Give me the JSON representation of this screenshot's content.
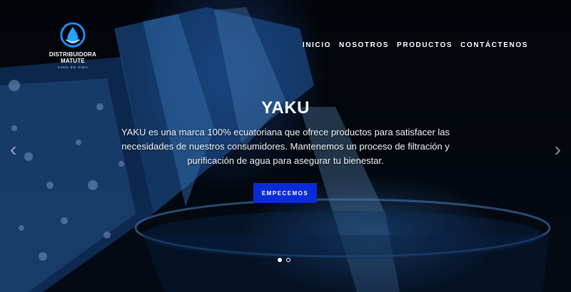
{
  "brand": {
    "name": "DISTRIBUIDORA MATUTE",
    "tagline": "YAKU ES VIDA",
    "accent": "#1e90ff"
  },
  "nav": {
    "items": [
      {
        "label": "INICIO"
      },
      {
        "label": "NOSOTROS"
      },
      {
        "label": "PRODUCTOS"
      },
      {
        "label": "CONTÁCTENOS"
      }
    ]
  },
  "hero": {
    "title": "YAKU",
    "description": "YAKU es una marca 100% ecuatoriana que ofrece productos para satisfacer las necesidades de nuestros consumidores. Mantenemos un proceso de filtración y purificación de agua para asegurar tu bienestar.",
    "cta_label": "EMPECEMOS",
    "cta_color": "#0a2bd8"
  },
  "carousel": {
    "prev_icon": "chevron-left-icon",
    "next_icon": "chevron-right-icon",
    "slides_total": 2,
    "active_slide": 1
  }
}
